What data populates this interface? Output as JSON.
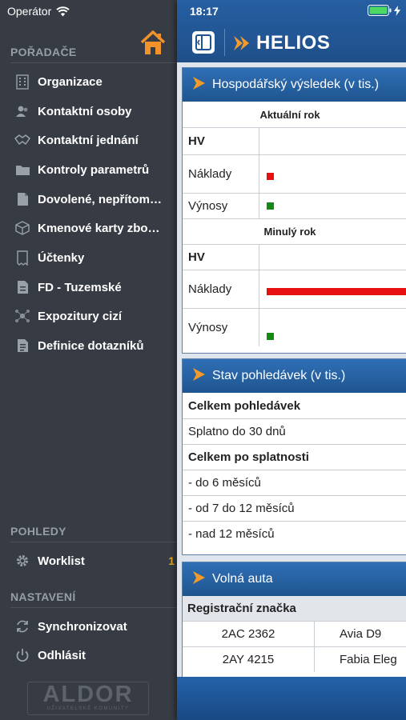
{
  "status": {
    "carrier": "Operátor",
    "time": "18:17"
  },
  "sidebar": {
    "section_porad": "POŘADAČE",
    "items": [
      {
        "label": "Organizace",
        "icon": "building-icon"
      },
      {
        "label": "Kontaktní osoby",
        "icon": "contacts-icon"
      },
      {
        "label": "Kontaktní jednání",
        "icon": "handshake-icon"
      },
      {
        "label": "Kontroly parametrů",
        "icon": "folder-icon"
      },
      {
        "label": "Dovolené, nepřítom…",
        "icon": "document-icon"
      },
      {
        "label": "Kmenové karty zbo…",
        "icon": "cube-icon"
      },
      {
        "label": "Účtenky",
        "icon": "receipt-icon"
      },
      {
        "label": "FD - Tuzemské",
        "icon": "invoice-icon"
      },
      {
        "label": "Expozitury cizí",
        "icon": "network-icon"
      },
      {
        "label": "Definice dotazníků",
        "icon": "form-icon"
      }
    ],
    "section_pohledy": "POHLEDY",
    "worklist": {
      "label": "Worklist",
      "badge": "1"
    },
    "section_nastaveni": "NASTAVENÍ",
    "sync_label": "Synchronizovat",
    "logout_label": "Odhlásit",
    "logo_main": "ALDOR",
    "logo_sub": "UŽIVATELSKÉ KOMUNITY"
  },
  "header": {
    "logo_text": "HELIOS"
  },
  "panels": {
    "hv": {
      "title": "Hospodářský výsledek (v tis.)",
      "current_label": "Aktuální rok",
      "previous_label": "Minulý rok",
      "hv_label": "HV",
      "costs_label": "Náklady",
      "revenue_label": "Výnosy"
    },
    "receivables": {
      "title": "Stav pohledávek (v tis.)",
      "rows": [
        {
          "label": "Celkem pohledávek",
          "bold": true
        },
        {
          "label": "Splatno do 30 dnů",
          "bold": false
        },
        {
          "label": "Celkem po splatnosti",
          "bold": true
        },
        {
          "label": "- do 6 měsíců",
          "bold": false
        },
        {
          "label": "- od 7 do 12 měsíců",
          "bold": false
        },
        {
          "label": "- nad 12 měsíců",
          "bold": false
        }
      ]
    },
    "cars": {
      "title": "Volná auta",
      "col_header": "Registrační značka",
      "rows": [
        {
          "plate": "2AC 2362",
          "model": "Avia D9"
        },
        {
          "plate": "2AY 4215",
          "model": "Fabia Eleg"
        }
      ]
    }
  },
  "bar_colors": {
    "costs": "#e61010",
    "revenue": "#148a14"
  },
  "bars": {
    "current_costs": 0.03,
    "current_revenue": 0.03,
    "previous_costs": 1.0,
    "previous_revenue": 0.03
  }
}
